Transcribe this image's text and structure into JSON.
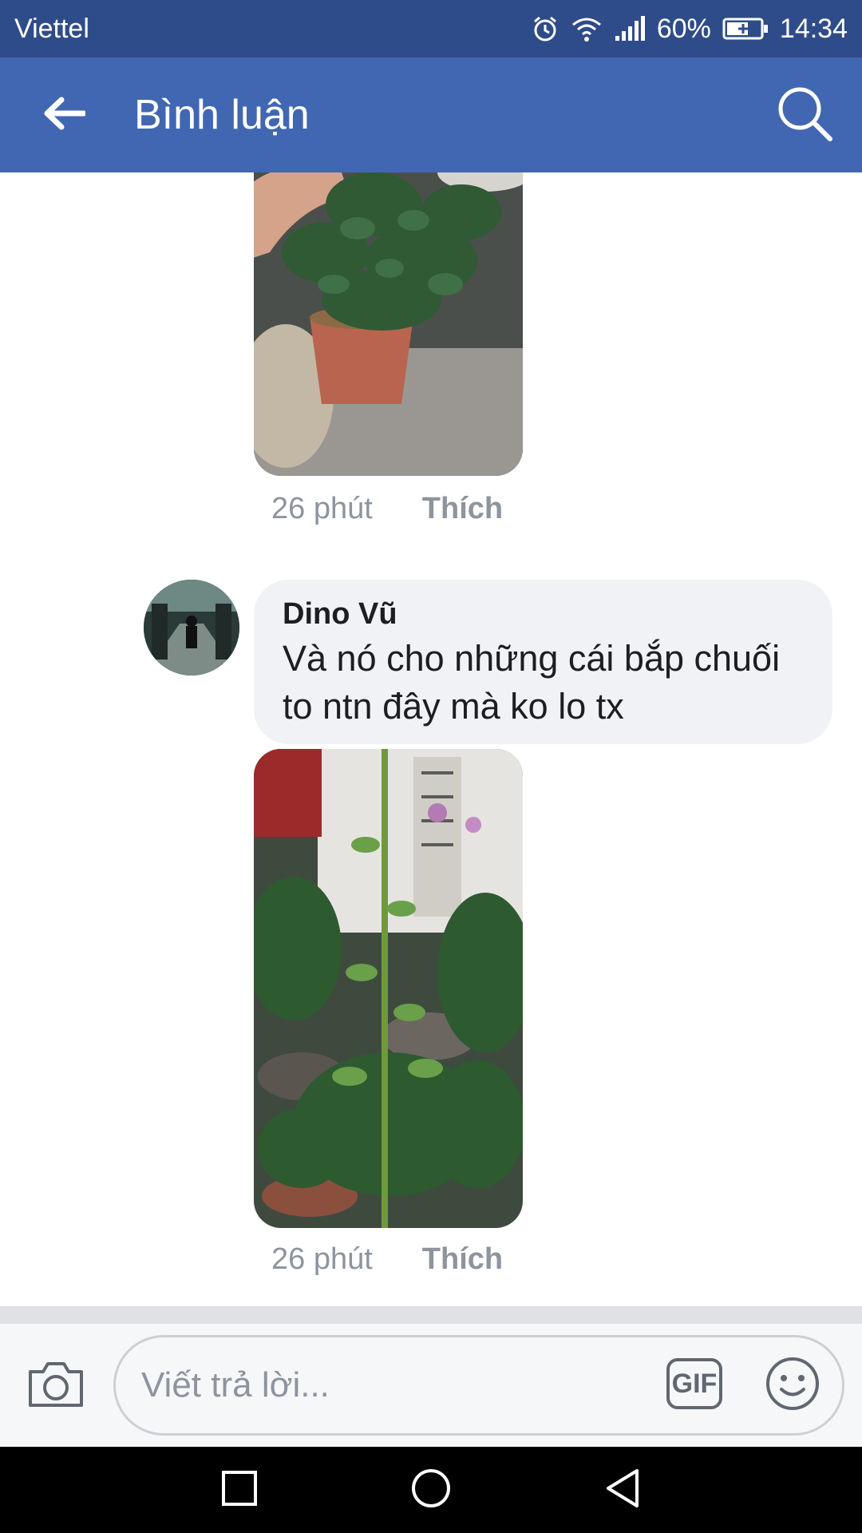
{
  "status_bar": {
    "carrier": "Viettel",
    "battery": "60%",
    "time": "14:34"
  },
  "app_bar": {
    "title": "Bình luận"
  },
  "comments": [
    {
      "time": "26 phút",
      "like_label": "Thích"
    },
    {
      "author": "Dino Vũ",
      "text": "Và nó cho những cái bắp chuối to ntn đây mà ko lo tx",
      "time": "26 phút",
      "like_label": "Thích"
    }
  ],
  "composer": {
    "placeholder": "Viết trả lời...",
    "gif_label": "GIF"
  },
  "icons": [
    "alarm-icon",
    "wifi-icon",
    "signal-icon",
    "battery-icon",
    "back-arrow-icon",
    "search-icon",
    "camera-icon",
    "emoji-icon",
    "recent-apps-icon",
    "home-icon",
    "back-nav-icon"
  ],
  "colors": {
    "status_bar": "#2f4c8a",
    "app_bar": "#4267b2",
    "bubble": "#f0f2f5",
    "meta_text": "#8d949e"
  }
}
